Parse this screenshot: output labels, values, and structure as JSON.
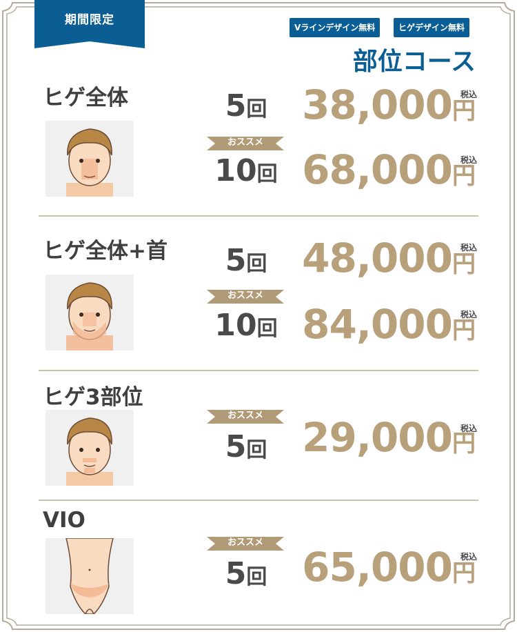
{
  "tag": {
    "label": "期間限定"
  },
  "badges": [
    "Vラインデザイン無料",
    "ヒゲデザイン無料"
  ],
  "course_title": "部位コース",
  "colors": {
    "brand_blue": "#0b5e93",
    "gold": "#b7a07a",
    "ribbon": "#b09a77",
    "frame": "#b5ab98"
  },
  "sections": [
    {
      "title": "ヒゲ全体",
      "image_icon": "beard-area-face",
      "plans": [
        {
          "count": "5",
          "unit": "回",
          "recommend": "",
          "price": "38,000",
          "currency": "円",
          "tax": "税込"
        },
        {
          "count": "10",
          "unit": "回",
          "recommend": "おススメ",
          "price": "68,000",
          "currency": "円",
          "tax": "税込"
        }
      ]
    },
    {
      "title": "ヒゲ全体+首",
      "image_icon": "beard-neck-face",
      "plans": [
        {
          "count": "5",
          "unit": "回",
          "recommend": "",
          "price": "48,000",
          "currency": "円",
          "tax": "税込"
        },
        {
          "count": "10",
          "unit": "回",
          "recommend": "おススメ",
          "price": "84,000",
          "currency": "円",
          "tax": "税込"
        }
      ]
    },
    {
      "title": "ヒゲ3部位",
      "image_icon": "beard-3-parts-face",
      "plans": [
        {
          "count": "5",
          "unit": "回",
          "recommend": "おススメ",
          "price": "29,000",
          "currency": "円",
          "tax": "税込"
        }
      ]
    },
    {
      "title": "VIO",
      "image_icon": "vio-area",
      "plans": [
        {
          "count": "5",
          "unit": "回",
          "recommend": "おススメ",
          "price": "65,000",
          "currency": "円",
          "tax": "税込"
        }
      ]
    }
  ]
}
